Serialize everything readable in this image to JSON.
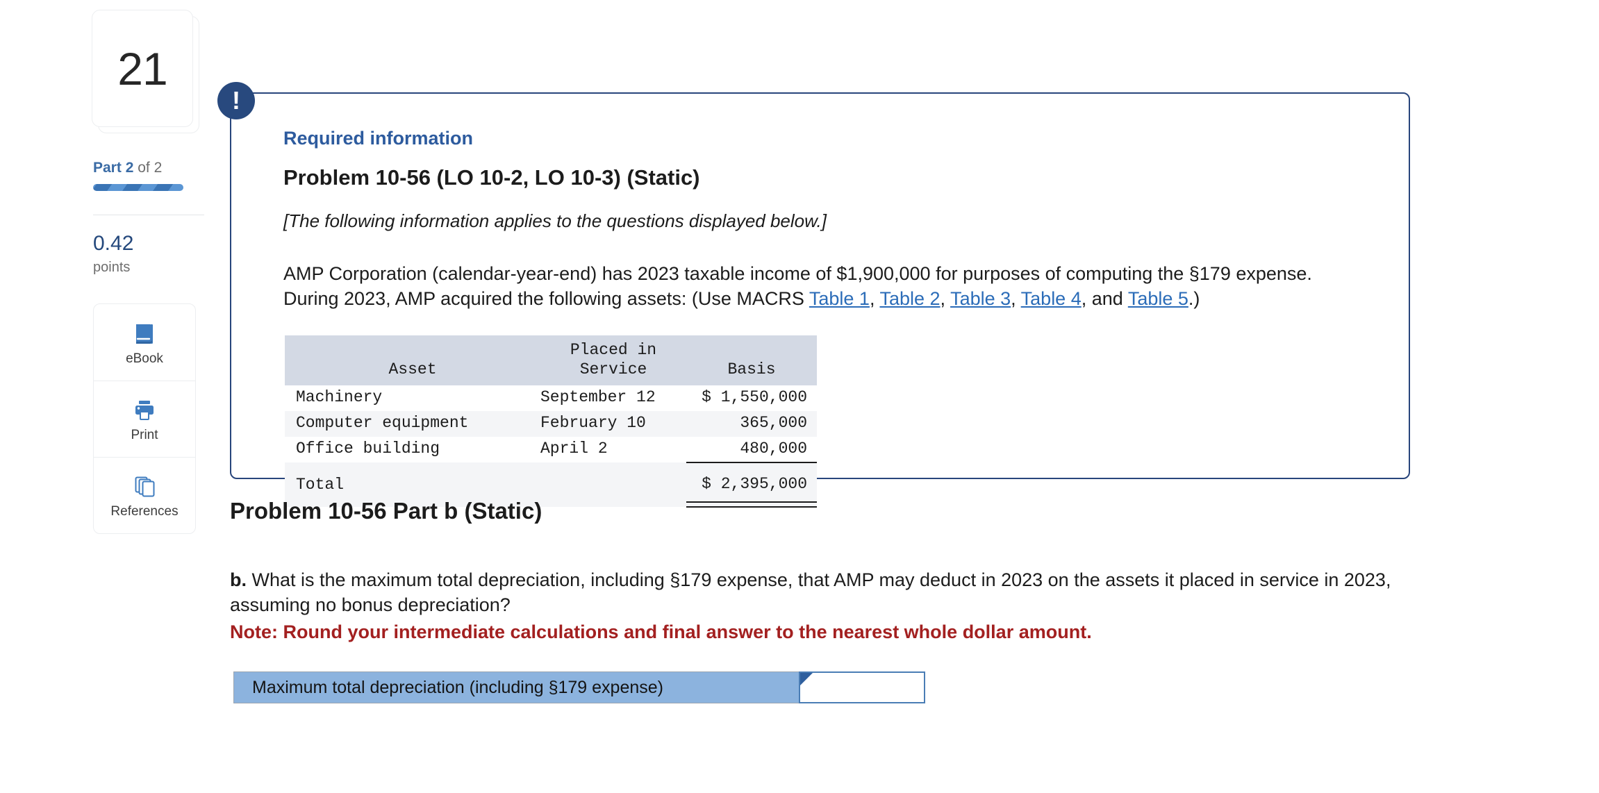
{
  "sidebar": {
    "question_number": "21",
    "part_prefix": "Part",
    "part_current": "2",
    "part_of": "of",
    "part_total": "2",
    "points_value": "0.42",
    "points_label": "points",
    "tools": [
      {
        "label": "eBook",
        "icon": "ebook-icon"
      },
      {
        "label": "Print",
        "icon": "printer-icon"
      },
      {
        "label": "References",
        "icon": "references-icon"
      }
    ]
  },
  "required_card": {
    "badge_glyph": "!",
    "kicker": "Required information",
    "title": "Problem 10-56 (LO 10-2, LO 10-3) (Static)",
    "italic_note": "[The following information applies to the questions displayed below.]",
    "body_part1": "AMP Corporation (calendar-year-end) has 2023 taxable income of $1,900,000 for purposes of computing the §179 expense. During 2023, AMP acquired the following assets: (Use MACRS ",
    "links": [
      {
        "label": "Table 1"
      },
      {
        "label": "Table 2"
      },
      {
        "label": "Table 3"
      },
      {
        "label": "Table 4"
      },
      {
        "label": "Table 5"
      }
    ],
    "sep_comma": ", ",
    "sep_and": ", and ",
    "body_end": ".)"
  },
  "asset_table": {
    "headers": {
      "asset": "Asset",
      "placed_line1": "Placed in",
      "placed_line2": "Service",
      "basis": "Basis"
    },
    "rows": [
      {
        "asset": "Machinery",
        "service": "September 12",
        "basis": "$ 1,550,000"
      },
      {
        "asset": "Computer equipment",
        "service": "February 10",
        "basis": "365,000"
      },
      {
        "asset": "Office building",
        "service": "April 2",
        "basis": "480,000"
      }
    ],
    "total": {
      "asset": "Total",
      "service": "",
      "basis": "$ 2,395,000"
    }
  },
  "part_b": {
    "title": "Problem 10-56 Part b (Static)",
    "question_marker": "b.",
    "question_text": " What is the maximum total depreciation, including §179 expense, that AMP may deduct in 2023 on the assets it placed in service in 2023, assuming no bonus depreciation?",
    "note": "Note: Round your intermediate calculations and final answer to the nearest whole dollar amount."
  },
  "answer": {
    "label": "Maximum total depreciation (including §179 expense)",
    "value": "",
    "placeholder": ""
  },
  "colors": {
    "accent_blue": "#2d5b9e",
    "badge_navy": "#28497e",
    "card_border": "#28457c",
    "note_red": "#a32020",
    "answer_row_blue": "#8cb3de",
    "link_blue": "#2b6cb8",
    "table_header_bg": "#d3d9e4"
  }
}
